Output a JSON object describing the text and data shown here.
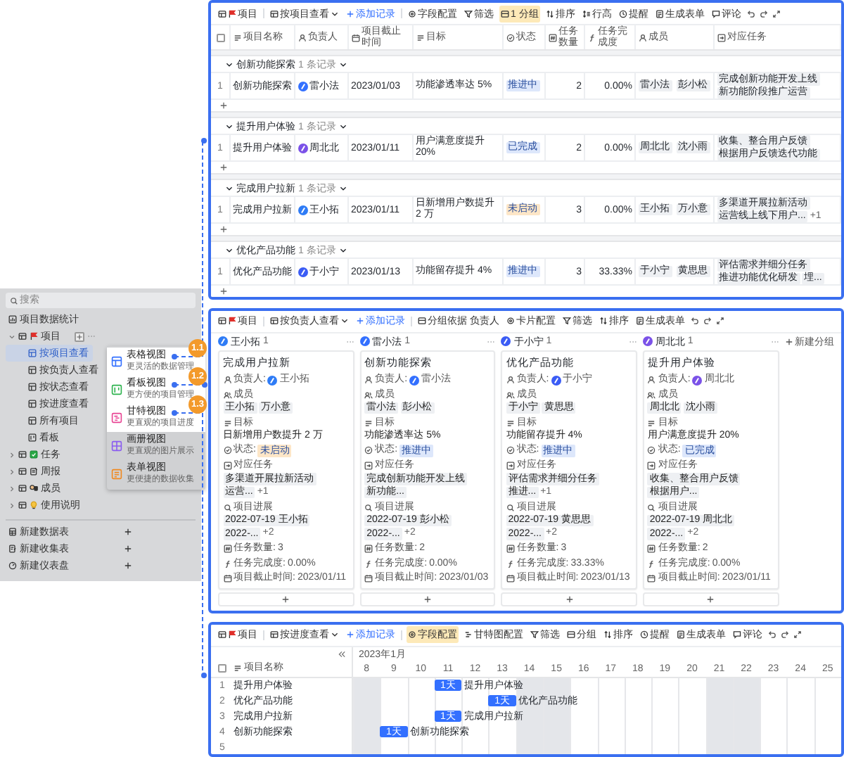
{
  "sidebar": {
    "search": {
      "placeholder": "搜索"
    },
    "stat_item": {
      "label": "项目数据统计"
    },
    "tree": [
      {
        "label": "项目",
        "kind": "flag",
        "expanded": true,
        "hovered": true,
        "children": [
          {
            "label": "按项目查看",
            "kind": "view",
            "selected": true
          },
          {
            "label": "按负责人查看",
            "kind": "view",
            "selected": false
          },
          {
            "label": "按状态查看",
            "kind": "view",
            "selected": false
          },
          {
            "label": "按进度查看",
            "kind": "view",
            "selected": false
          },
          {
            "label": "所有项目",
            "kind": "view",
            "selected": false
          },
          {
            "label": "看板",
            "kind": "board",
            "selected": false
          }
        ]
      },
      {
        "label": "任务",
        "kind": "task",
        "expanded": false,
        "hovered": false
      },
      {
        "label": "周报",
        "kind": "note",
        "expanded": false,
        "hovered": false
      },
      {
        "label": "成员",
        "kind": "people",
        "expanded": false,
        "hovered": false
      },
      {
        "label": "使用说明",
        "kind": "bulb",
        "expanded": false,
        "hovered": false
      }
    ],
    "actions": [
      {
        "label": "新建数据表",
        "kind": "sheet"
      },
      {
        "label": "新建收集表",
        "kind": "collect"
      },
      {
        "label": "新建仪表盘",
        "kind": "dashboard"
      }
    ]
  },
  "view_menu": {
    "items": [
      {
        "title": "表格视图",
        "subtitle": "更灵活的数据管理",
        "kind": "table",
        "color": "#3370ff",
        "highlighted": true
      },
      {
        "title": "看板视图",
        "subtitle": "更方便的项目管理",
        "kind": "board",
        "color": "#2bb24c",
        "highlighted": true
      },
      {
        "title": "甘特视图",
        "subtitle": "更直观的项目进度",
        "kind": "gantt",
        "color": "#e84393",
        "highlighted": true
      },
      {
        "title": "画册视图",
        "subtitle": "更直观的图片展示",
        "kind": "gallery",
        "color": "#8a5cf0",
        "highlighted": false
      },
      {
        "title": "表单视图",
        "subtitle": "更便捷的数据收集",
        "kind": "form",
        "color": "#f0891f",
        "highlighted": false
      }
    ]
  },
  "callouts": [
    {
      "label": "1.1"
    },
    {
      "label": "1.2"
    },
    {
      "label": "1.3"
    }
  ],
  "table_view": {
    "toolbar": [
      {
        "kind": "view-name",
        "label": "项目"
      },
      {
        "kind": "view-select",
        "label": "按项目查看"
      },
      {
        "kind": "add",
        "label": "添加记录"
      },
      {
        "kind": "fields",
        "label": "字段配置",
        "highlighted": false
      },
      {
        "kind": "filter",
        "label": "筛选",
        "highlighted": false
      },
      {
        "kind": "group",
        "label": "1 分组",
        "highlighted": true
      },
      {
        "kind": "sort",
        "label": "排序",
        "highlighted": false
      },
      {
        "kind": "row-height",
        "label": "行高",
        "highlighted": false
      },
      {
        "kind": "remind",
        "label": "提醒",
        "highlighted": false
      },
      {
        "kind": "form",
        "label": "生成表单",
        "highlighted": false
      },
      {
        "kind": "comment",
        "label": "评论",
        "highlighted": false
      },
      {
        "kind": "undo"
      },
      {
        "kind": "redo"
      },
      {
        "kind": "expand"
      }
    ],
    "select_all": {
      "checked": false
    },
    "columns": [
      {
        "label": "项目名称",
        "kind": "text"
      },
      {
        "label": "负责人",
        "kind": "person"
      },
      {
        "label": "项目截止时间",
        "kind": "date"
      },
      {
        "label": "目标",
        "kind": "text"
      },
      {
        "label": "状态",
        "kind": "status"
      },
      {
        "label": "任务数量",
        "kind": "number"
      },
      {
        "label": "任务完成度",
        "kind": "formula"
      },
      {
        "label": "成员",
        "kind": "person"
      },
      {
        "label": "对应任务",
        "kind": "link"
      }
    ],
    "groups": [
      {
        "name": "创新功能探索",
        "count": "1 条记录",
        "rows": [
          {
            "index": "1",
            "name": "创新功能探索",
            "owner": {
              "name": "雷小法",
              "color": "#3370ff"
            },
            "deadline": "2023/01/03",
            "goal": "功能渗透率达 5%",
            "status": {
              "label": "推进中",
              "color": "#dde7fb"
            },
            "task_count": "2",
            "completion": "0.00%",
            "members": [
              "雷小法",
              "彭小松"
            ],
            "tasks": [
              "完成创新功能开发上线",
              "新功能阶段推广运营"
            ]
          }
        ]
      },
      {
        "name": "提升用户体验",
        "count": "1 条记录",
        "rows": [
          {
            "index": "1",
            "name": "提升用户体验",
            "owner": {
              "name": "周北北",
              "color": "#7b52e8"
            },
            "deadline": "2023/01/11",
            "goal": "用户满意度提升 20%",
            "status": {
              "label": "已完成",
              "color": "#dde7fb"
            },
            "task_count": "2",
            "completion": "0.00%",
            "members": [
              "周北北",
              "沈小雨"
            ],
            "tasks": [
              "收集、整合用户反馈",
              "根据用户反馈迭代功能"
            ]
          }
        ]
      },
      {
        "name": "完成用户拉新",
        "count": "1 条记录",
        "rows": [
          {
            "index": "1",
            "name": "完成用户拉新",
            "owner": {
              "name": "王小拓",
              "color": "#2f7cf6"
            },
            "deadline": "2023/01/11",
            "goal": "日新增用户数提升 2 万",
            "status": {
              "label": "未启动",
              "color": "#fde6c7"
            },
            "task_count": "3",
            "completion": "0.00%",
            "members": [
              "王小拓",
              "万小意"
            ],
            "tasks": [
              "多渠道开展拉新活动",
              "运营线上线下用户..."
            ],
            "more": "+1"
          }
        ]
      },
      {
        "name": "优化产品功能",
        "count": "1 条记录",
        "rows": [
          {
            "index": "1",
            "name": "优化产品功能",
            "owner": {
              "name": "于小宁",
              "color": "#3b5cf5"
            },
            "deadline": "2023/01/13",
            "goal": "功能留存提升 4%",
            "status": {
              "label": "推进中",
              "color": "#dde7fb"
            },
            "task_count": "3",
            "completion": "33.33%",
            "members": [
              "于小宁",
              "黄思思"
            ],
            "tasks": [
              "评估需求并细分任务",
              "推进功能优化研发",
              "埋..."
            ]
          }
        ]
      }
    ]
  },
  "kanban_view": {
    "toolbar": [
      {
        "kind": "view-name",
        "label": "项目"
      },
      {
        "kind": "view-select",
        "label": "按负责人查看"
      },
      {
        "kind": "add",
        "label": "添加记录"
      },
      {
        "kind": "group",
        "label": "分组依据 负责人",
        "highlighted": false
      },
      {
        "kind": "card-config",
        "label": "卡片配置",
        "highlighted": false
      },
      {
        "kind": "filter",
        "label": "筛选",
        "highlighted": false
      },
      {
        "kind": "sort",
        "label": "排序",
        "highlighted": false
      },
      {
        "kind": "form",
        "label": "生成表单",
        "highlighted": false
      },
      {
        "kind": "undo"
      },
      {
        "kind": "redo"
      },
      {
        "kind": "expand"
      }
    ],
    "new_group": "新建分组",
    "columns": [
      {
        "owner": "王小拓",
        "color": "#2f7cf6",
        "count": "1",
        "cards": [
          {
            "title": "完成用户拉新",
            "fields": [
              {
                "kind": "person",
                "label": "负责人:",
                "name": "王小拓",
                "color": "#2f7cf6"
              },
              {
                "kind": "members",
                "label": "成员",
                "tags": [
                  "王小拓",
                  "万小意"
                ]
              },
              {
                "kind": "text",
                "label": "目标",
                "value": "日新增用户数提升 2 万"
              },
              {
                "kind": "status",
                "label": "状态:",
                "value": "未启动",
                "color": "#fde6c7"
              },
              {
                "kind": "tasks",
                "label": "对应任务",
                "tags": [
                  "多渠道开展拉新活动",
                  "运营..."
                ],
                "more": "+1"
              },
              {
                "kind": "progress",
                "label": "项目进展",
                "tags": [
                  "2022-07-19 王小拓",
                  "2022-..."
                ],
                "more": "+2"
              },
              {
                "kind": "number",
                "label": "任务数量:",
                "value": "3"
              },
              {
                "kind": "formula",
                "label": "任务完成度:",
                "value": "0.00%"
              },
              {
                "kind": "date",
                "label": "项目截止时间:",
                "value": "2023/01/11"
              }
            ]
          }
        ]
      },
      {
        "owner": "雷小法",
        "color": "#3370ff",
        "count": "1",
        "cards": [
          {
            "title": "创新功能探索",
            "fields": [
              {
                "kind": "person",
                "label": "负责人:",
                "name": "雷小法",
                "color": "#3370ff"
              },
              {
                "kind": "members",
                "label": "成员",
                "tags": [
                  "雷小法",
                  "彭小松"
                ]
              },
              {
                "kind": "text",
                "label": "目标",
                "value": "功能渗透率达 5%"
              },
              {
                "kind": "status",
                "label": "状态:",
                "value": "推进中",
                "color": "#dde7fb"
              },
              {
                "kind": "tasks",
                "label": "对应任务",
                "tags": [
                  "完成创新功能开发上线",
                  "新功能..."
                ]
              },
              {
                "kind": "progress",
                "label": "项目进展",
                "tags": [
                  "2022-07-19 彭小松",
                  "2022-..."
                ],
                "more": "+2"
              },
              {
                "kind": "number",
                "label": "任务数量:",
                "value": "2"
              },
              {
                "kind": "formula",
                "label": "任务完成度:",
                "value": "0.00%"
              },
              {
                "kind": "date",
                "label": "项目截止时间:",
                "value": "2023/01/03"
              }
            ]
          }
        ]
      },
      {
        "owner": "于小宁",
        "color": "#3b5cf5",
        "count": "1",
        "cards": [
          {
            "title": "优化产品功能",
            "fields": [
              {
                "kind": "person",
                "label": "负责人:",
                "name": "于小宁",
                "color": "#3b5cf5"
              },
              {
                "kind": "members",
                "label": "成员",
                "tags": [
                  "于小宁",
                  "黄思思"
                ]
              },
              {
                "kind": "text",
                "label": "目标",
                "value": "功能留存提升 4%"
              },
              {
                "kind": "status",
                "label": "状态:",
                "value": "推进中",
                "color": "#dde7fb"
              },
              {
                "kind": "tasks",
                "label": "对应任务",
                "tags": [
                  "评估需求并细分任务",
                  "推进..."
                ],
                "more": "+1"
              },
              {
                "kind": "progress",
                "label": "项目进展",
                "tags": [
                  "2022-07-19 黄思思",
                  "2022-..."
                ],
                "more": "+2"
              },
              {
                "kind": "number",
                "label": "任务数量:",
                "value": "3"
              },
              {
                "kind": "formula",
                "label": "任务完成度:",
                "value": "33.33%"
              },
              {
                "kind": "date",
                "label": "项目截止时间:",
                "value": "2023/01/13"
              }
            ]
          }
        ]
      },
      {
        "owner": "周北北",
        "color": "#7b52e8",
        "count": "1",
        "cards": [
          {
            "title": "提升用户体验",
            "fields": [
              {
                "kind": "person",
                "label": "负责人:",
                "name": "周北北",
                "color": "#7b52e8"
              },
              {
                "kind": "members",
                "label": "成员",
                "tags": [
                  "周北北",
                  "沈小雨"
                ]
              },
              {
                "kind": "text",
                "label": "目标",
                "value": "用户满意度提升 20%"
              },
              {
                "kind": "status",
                "label": "状态:",
                "value": "已完成",
                "color": "#dde7fb"
              },
              {
                "kind": "tasks",
                "label": "对应任务",
                "tags": [
                  "收集、整合用户反馈",
                  "根据用户..."
                ]
              },
              {
                "kind": "progress",
                "label": "项目进展",
                "tags": [
                  "2022-07-19 周北北",
                  "2022-..."
                ],
                "more": "+2"
              },
              {
                "kind": "number",
                "label": "任务数量:",
                "value": "2"
              },
              {
                "kind": "formula",
                "label": "任务完成度:",
                "value": "0.00%"
              },
              {
                "kind": "date",
                "label": "项目截止时间:",
                "value": "2023/01/11"
              }
            ]
          }
        ]
      }
    ]
  },
  "gantt_view": {
    "toolbar": [
      {
        "kind": "view-name",
        "label": "项目"
      },
      {
        "kind": "view-select",
        "label": "按进度查看"
      },
      {
        "kind": "add",
        "label": "添加记录"
      },
      {
        "kind": "fields",
        "label": "字段配置",
        "highlighted": true
      },
      {
        "kind": "gantt-config",
        "label": "甘特图配置",
        "highlighted": false
      },
      {
        "kind": "filter",
        "label": "筛选",
        "highlighted": false
      },
      {
        "kind": "group",
        "label": "分组",
        "highlighted": false
      },
      {
        "kind": "sort",
        "label": "排序",
        "highlighted": false
      },
      {
        "kind": "remind",
        "label": "提醒",
        "highlighted": false
      },
      {
        "kind": "form",
        "label": "生成表单",
        "highlighted": false
      },
      {
        "kind": "comment",
        "label": "评论",
        "highlighted": false
      },
      {
        "kind": "undo"
      },
      {
        "kind": "redo"
      },
      {
        "kind": "expand"
      }
    ],
    "select_all": {
      "checked": false
    },
    "column": "项目名称",
    "month": "2023年1月",
    "days": [
      {
        "label": "8",
        "weekend": true
      },
      {
        "label": "9",
        "weekend": false
      },
      {
        "label": "10",
        "weekend": false
      },
      {
        "label": "11",
        "weekend": false
      },
      {
        "label": "12",
        "weekend": false
      },
      {
        "label": "13",
        "weekend": false
      },
      {
        "label": "14",
        "weekend": true
      },
      {
        "label": "15",
        "weekend": true
      },
      {
        "label": "16",
        "weekend": false
      },
      {
        "label": "17",
        "weekend": false
      },
      {
        "label": "18",
        "weekend": false
      },
      {
        "label": "19",
        "weekend": false
      },
      {
        "label": "20",
        "weekend": false
      },
      {
        "label": "21",
        "weekend": true
      },
      {
        "label": "22",
        "weekend": true
      },
      {
        "label": "23",
        "weekend": false
      },
      {
        "label": "24",
        "weekend": false
      },
      {
        "label": "25",
        "weekend": false
      }
    ],
    "rows": [
      {
        "index": "1",
        "name": "提升用户体验",
        "cells": [
          {
            "bar": false
          },
          {
            "bar": false
          },
          {
            "bar": false
          },
          {
            "bar": true,
            "label": "1天",
            "title": "提升用户体验"
          },
          {
            "bar": false
          },
          {
            "bar": false
          },
          {
            "bar": false
          },
          {
            "bar": false
          },
          {
            "bar": false
          },
          {
            "bar": false
          },
          {
            "bar": false
          },
          {
            "bar": false
          },
          {
            "bar": false
          },
          {
            "bar": false
          },
          {
            "bar": false
          },
          {
            "bar": false
          },
          {
            "bar": false
          },
          {
            "bar": false
          }
        ]
      },
      {
        "index": "2",
        "name": "优化产品功能",
        "cells": [
          {
            "bar": false
          },
          {
            "bar": false
          },
          {
            "bar": false
          },
          {
            "bar": false
          },
          {
            "bar": false
          },
          {
            "bar": true,
            "label": "1天",
            "title": "优化产品功能"
          },
          {
            "bar": false
          },
          {
            "bar": false
          },
          {
            "bar": false
          },
          {
            "bar": false
          },
          {
            "bar": false
          },
          {
            "bar": false
          },
          {
            "bar": false
          },
          {
            "bar": false
          },
          {
            "bar": false
          },
          {
            "bar": false
          },
          {
            "bar": false
          },
          {
            "bar": false
          }
        ]
      },
      {
        "index": "3",
        "name": "完成用户拉新",
        "cells": [
          {
            "bar": false
          },
          {
            "bar": false
          },
          {
            "bar": false
          },
          {
            "bar": true,
            "label": "1天",
            "title": "完成用户拉新"
          },
          {
            "bar": false
          },
          {
            "bar": false
          },
          {
            "bar": false
          },
          {
            "bar": false
          },
          {
            "bar": false
          },
          {
            "bar": false
          },
          {
            "bar": false
          },
          {
            "bar": false
          },
          {
            "bar": false
          },
          {
            "bar": false
          },
          {
            "bar": false
          },
          {
            "bar": false
          },
          {
            "bar": false
          },
          {
            "bar": false
          }
        ]
      },
      {
        "index": "4",
        "name": "创新功能探索",
        "cells": [
          {
            "bar": false
          },
          {
            "bar": true,
            "label": "1天",
            "title": "创新功能探索"
          },
          {
            "bar": false
          },
          {
            "bar": false
          },
          {
            "bar": false
          },
          {
            "bar": false
          },
          {
            "bar": false
          },
          {
            "bar": false
          },
          {
            "bar": false
          },
          {
            "bar": false
          },
          {
            "bar": false
          },
          {
            "bar": false
          },
          {
            "bar": false
          },
          {
            "bar": false
          },
          {
            "bar": false
          },
          {
            "bar": false
          },
          {
            "bar": false
          },
          {
            "bar": false
          }
        ]
      },
      {
        "index": "5",
        "cells": [
          {
            "bar": false
          },
          {
            "bar": false
          },
          {
            "bar": false
          },
          {
            "bar": false
          },
          {
            "bar": false
          },
          {
            "bar": false
          },
          {
            "bar": false
          },
          {
            "bar": false
          },
          {
            "bar": false
          },
          {
            "bar": false
          },
          {
            "bar": false
          },
          {
            "bar": false
          },
          {
            "bar": false
          },
          {
            "bar": false
          },
          {
            "bar": false
          },
          {
            "bar": false
          },
          {
            "bar": false
          },
          {
            "bar": false
          }
        ]
      }
    ]
  }
}
